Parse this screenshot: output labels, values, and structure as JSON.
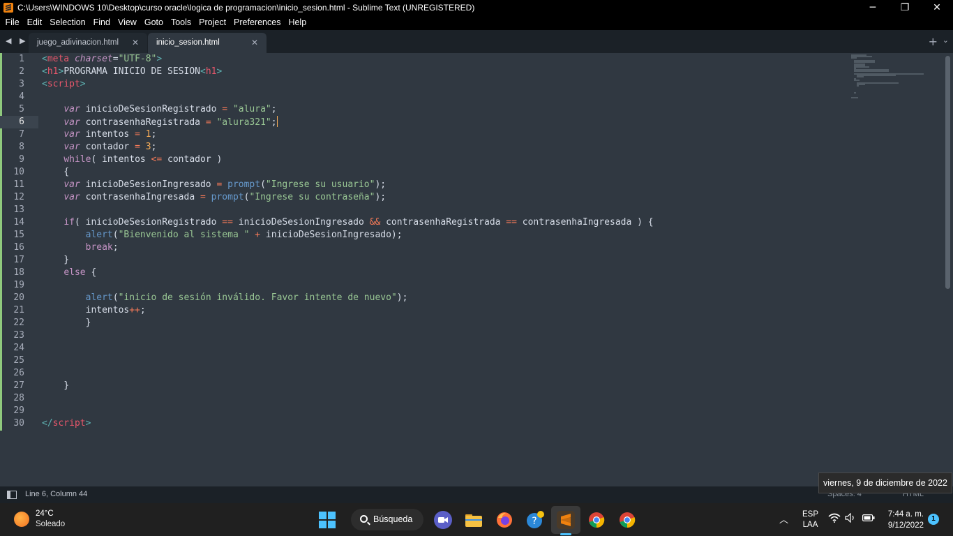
{
  "window": {
    "title": "C:\\Users\\WINDOWS 10\\Desktop\\curso oracle\\logica de programacion\\inicio_sesion.html - Sublime Text (UNREGISTERED)",
    "minimize": "─",
    "maximize": "❐",
    "close": "✕"
  },
  "menu": [
    "File",
    "Edit",
    "Selection",
    "Find",
    "View",
    "Goto",
    "Tools",
    "Project",
    "Preferences",
    "Help"
  ],
  "tabs": [
    {
      "label": "juego_adivinacion.html",
      "close": "✕"
    },
    {
      "label": "inicio_sesion.html",
      "close": "✕"
    }
  ],
  "tabbar": {
    "nav": "◀ ▶",
    "new_tab": "+",
    "dropdown": "⌄"
  },
  "editor": {
    "line_numbers": [
      "1",
      "2",
      "3",
      "4",
      "5",
      "6",
      "7",
      "8",
      "9",
      "10",
      "11",
      "12",
      "13",
      "14",
      "15",
      "16",
      "17",
      "18",
      "19",
      "20",
      "21",
      "22",
      "23",
      "24",
      "25",
      "26",
      "27",
      "28",
      "29",
      "30"
    ],
    "current_line": 6
  },
  "status": {
    "position": "Line 6, Column 44",
    "spaces": "Spaces: 4",
    "syntax": "HTML"
  },
  "tooltip": {
    "date": "viernes, 9 de diciembre de 2022"
  },
  "taskbar": {
    "weather_temp": "24°C",
    "weather_condition": "Soleado",
    "search_label": "Búsqueda",
    "language_top": "ESP",
    "language_bottom": "LAA",
    "time": "7:44 a. m.",
    "date": "9/12/2022",
    "notifications": "1"
  }
}
